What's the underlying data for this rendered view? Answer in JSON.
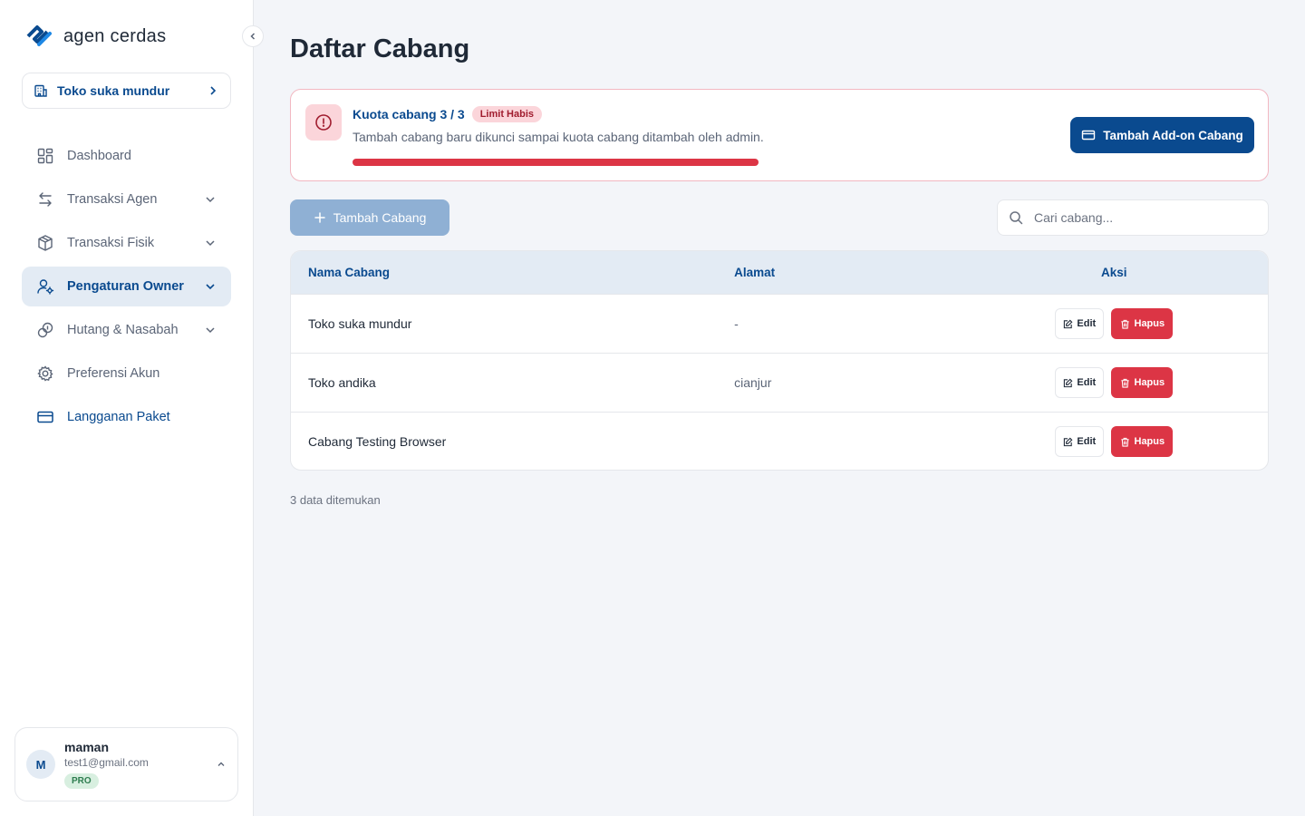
{
  "app": {
    "name": "agen cerdas"
  },
  "sidebar": {
    "store": "Toko suka mundur",
    "items": [
      {
        "label": "Dashboard",
        "icon": "dashboard-icon",
        "has_chevron": false
      },
      {
        "label": "Transaksi Agen",
        "icon": "arrows-swap-icon",
        "has_chevron": true
      },
      {
        "label": "Transaksi Fisik",
        "icon": "box-icon",
        "has_chevron": true
      },
      {
        "label": "Pengaturan Owner",
        "icon": "user-gear-icon",
        "has_chevron": true,
        "active": true
      },
      {
        "label": "Hutang & Nasabah",
        "icon": "coins-icon",
        "has_chevron": true
      },
      {
        "label": "Preferensi Akun",
        "icon": "gear-icon",
        "has_chevron": false
      },
      {
        "label": "Langganan Paket",
        "icon": "credit-card-icon",
        "has_chevron": false
      }
    ],
    "user": {
      "initial": "M",
      "name": "maman",
      "email": "test1@gmail.com",
      "plan": "PRO"
    }
  },
  "main": {
    "title": "Daftar Cabang",
    "quota": {
      "title": "Kuota cabang 3 / 3",
      "badge": "Limit Habis",
      "description": "Tambah cabang baru dikunci sampai kuota cabang ditambah oleh admin.",
      "used": 3,
      "total": 3,
      "addon_label": "Tambah Add-on Cabang"
    },
    "add_branch_label": "Tambah Cabang",
    "search": {
      "placeholder": "Cari cabang...",
      "value": ""
    },
    "table": {
      "headers": [
        "Nama Cabang",
        "Alamat",
        "Aksi"
      ],
      "edit_label": "Edit",
      "delete_label": "Hapus",
      "rows": [
        {
          "name": "Toko suka mundur",
          "address": "-"
        },
        {
          "name": "Toko andika",
          "address": "cianjur"
        },
        {
          "name": "Cabang Testing Browser",
          "address": ""
        }
      ]
    },
    "count_text": "3 data ditemukan"
  },
  "colors": {
    "primary": "#0a4a8f",
    "danger": "#dc3545",
    "disabled": "#8fb0d4"
  }
}
